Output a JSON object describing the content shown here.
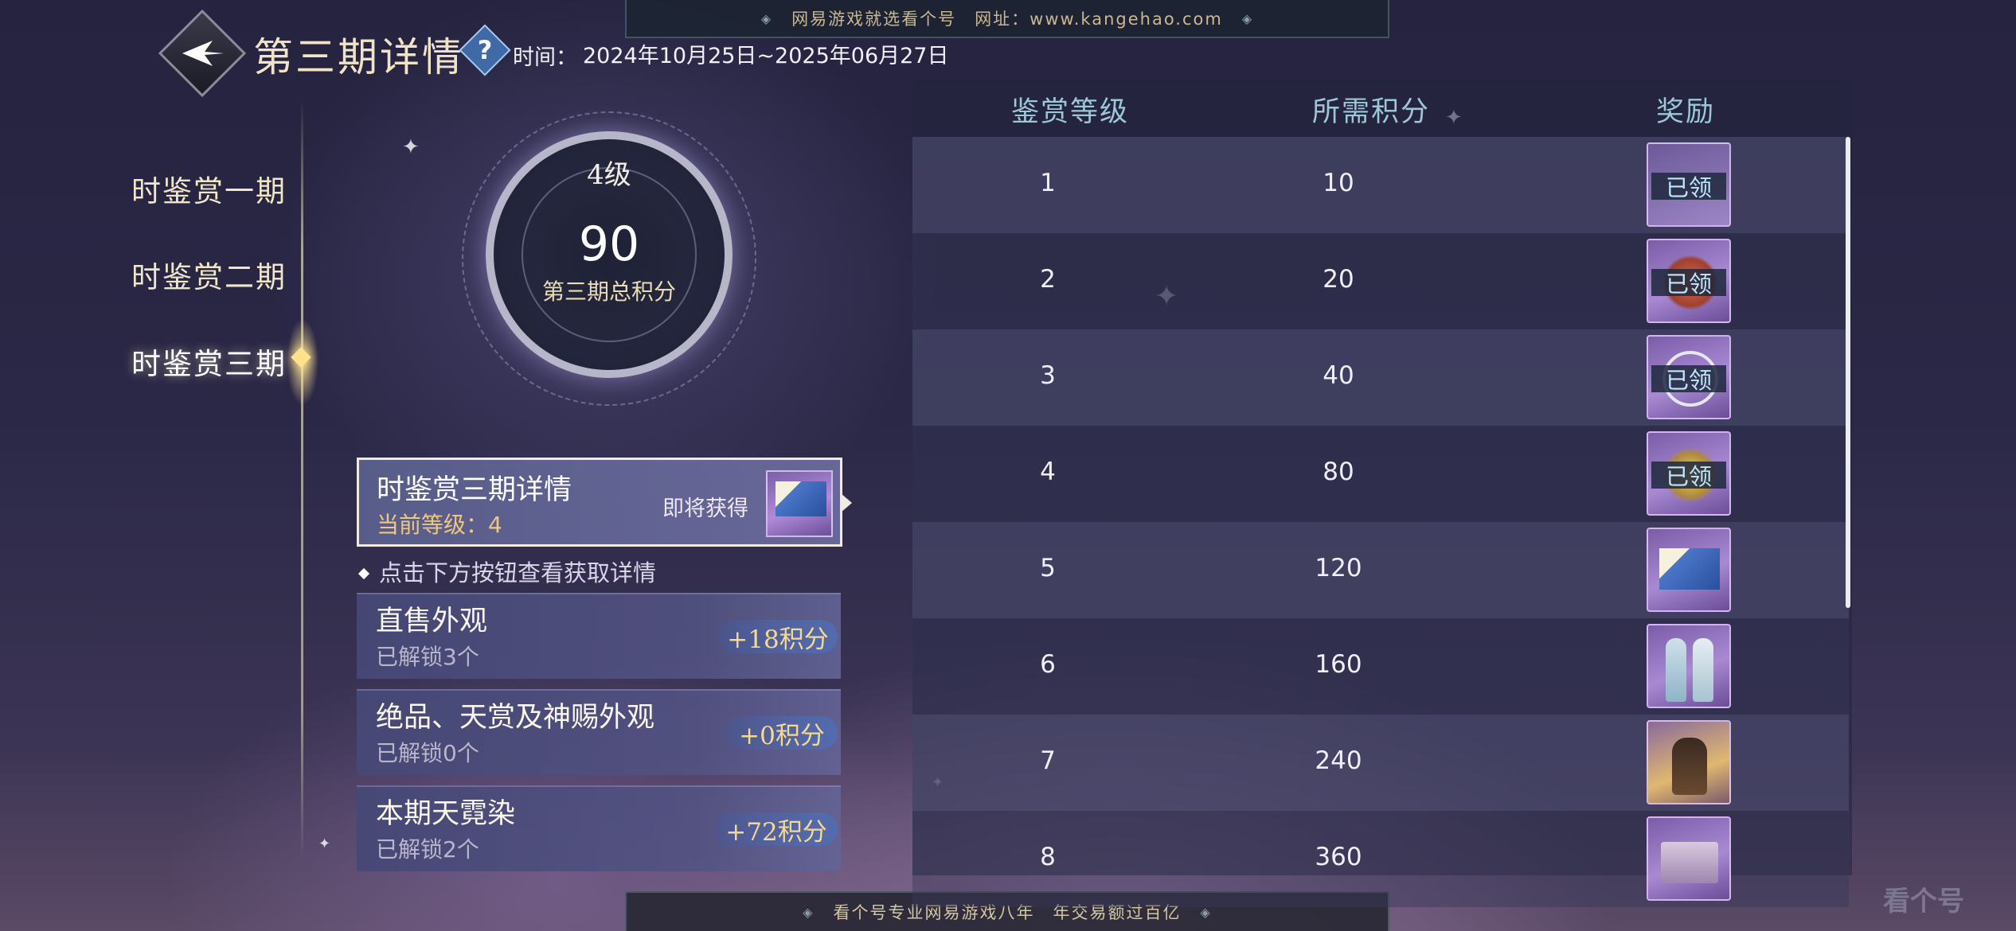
{
  "top_banner": {
    "text": "网易游戏就选看个号　网址：www.kangehao.com"
  },
  "bottom_banner": {
    "text": "看个号专业网易游戏八年　年交易额过百亿"
  },
  "header": {
    "title": "第三期详情",
    "help_icon": "question-icon",
    "back_icon": "back-arrow-icon",
    "period_label": "时间：",
    "period_value": "2024年10月25日~2025年06月27日"
  },
  "tabs": [
    {
      "label": "时鉴赏一期",
      "active": false
    },
    {
      "label": "时鉴赏二期",
      "active": false
    },
    {
      "label": "时鉴赏三期",
      "active": true
    }
  ],
  "score": {
    "level": "4级",
    "value": "90",
    "label": "第三期总积分"
  },
  "detail": {
    "title": "时鉴赏三期详情",
    "current_level": "当前等级：4",
    "soon_label": "即将获得"
  },
  "hint": "点击下方按钮查看获取详情",
  "sources": [
    {
      "title": "直售外观",
      "unlocked": "已解锁3个",
      "points": "+18积分"
    },
    {
      "title": "绝品、天赏及神赐外观",
      "unlocked": "已解锁0个",
      "points": "+0积分"
    },
    {
      "title": "本期天霓染",
      "unlocked": "已解锁2个",
      "points": "+72积分"
    }
  ],
  "table": {
    "headers": {
      "level": "鉴赏等级",
      "points": "所需积分",
      "reward": "奖励"
    },
    "rows": [
      {
        "level": "1",
        "points": "10",
        "claimed_label": "已领"
      },
      {
        "level": "2",
        "points": "20",
        "claimed_label": "已领"
      },
      {
        "level": "3",
        "points": "40",
        "claimed_label": "已领"
      },
      {
        "level": "4",
        "points": "80",
        "claimed_label": "已领"
      },
      {
        "level": "5",
        "points": "120",
        "claimed_label": ""
      },
      {
        "level": "6",
        "points": "160",
        "claimed_label": ""
      },
      {
        "level": "7",
        "points": "240",
        "claimed_label": ""
      },
      {
        "level": "8",
        "points": "360",
        "claimed_label": ""
      }
    ]
  },
  "watermark": "看个号"
}
